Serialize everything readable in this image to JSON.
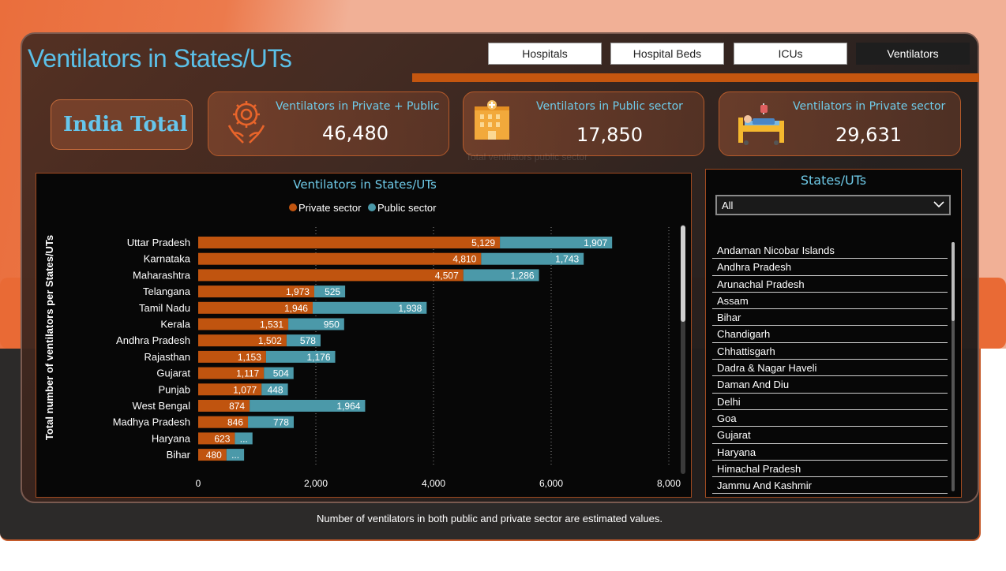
{
  "page": {
    "title": "Ventilators in States/UTs",
    "footer_note": "Number of ventilators in both public and private sector are estimated values."
  },
  "tabs": [
    {
      "label": "Hospitals",
      "active": false
    },
    {
      "label": "Hospital Beds",
      "active": false
    },
    {
      "label": "ICUs",
      "active": false
    },
    {
      "label": "Ventilators",
      "active": true
    }
  ],
  "india_total": {
    "label": "India Total"
  },
  "kpis": [
    {
      "label": "Ventilators in Private + Public",
      "value": "46,480",
      "icon": "hands-care-icon"
    },
    {
      "label": "Ventilators in Public sector",
      "value": "17,850",
      "icon": "hospital-building-icon"
    },
    {
      "label": "Ventilators in Private sector",
      "value": "29,631",
      "icon": "hospital-bed-icon"
    }
  ],
  "ghost_text": "Total ventilators public sector",
  "states_filter": {
    "title": "States/UTs",
    "selected": "All",
    "items": [
      "Andaman Nicobar Islands",
      "Andhra Pradesh",
      "Arunachal Pradesh",
      "Assam",
      "Bihar",
      "Chandigarh",
      "Chhattisgarh",
      "Dadra & Nagar Haveli",
      "Daman And Diu",
      "Delhi",
      "Goa",
      "Gujarat",
      "Haryana",
      "Himachal Pradesh",
      "Jammu And Kashmir"
    ]
  },
  "colors": {
    "private": "#c0540f",
    "public": "#4b99a9",
    "accent_blue": "#5bc0e8"
  },
  "chart_data": {
    "type": "bar",
    "orientation": "horizontal",
    "stacked": true,
    "title": "Ventilators in States/UTs",
    "ylabel": "Total number of ventilators per States/UTs",
    "xlabel": "",
    "xlim": [
      0,
      8000
    ],
    "x_ticks": [
      0,
      2000,
      4000,
      6000,
      8000
    ],
    "x_tick_labels": [
      "0",
      "2,000",
      "4,000",
      "6,000",
      "8,000"
    ],
    "grid": true,
    "legend_position": "top-center",
    "categories": [
      "Uttar Pradesh",
      "Karnataka",
      "Maharashtra",
      "Telangana",
      "Tamil Nadu",
      "Kerala",
      "Andhra Pradesh",
      "Rajasthan",
      "Gujarat",
      "Punjab",
      "West Bengal",
      "Madhya Pradesh",
      "Haryana",
      "Bihar"
    ],
    "series": [
      {
        "name": "Private sector",
        "values": [
          5129,
          4810,
          4507,
          1973,
          1946,
          1531,
          1502,
          1153,
          1117,
          1077,
          874,
          846,
          623,
          480
        ],
        "labels": [
          "5,129",
          "4,810",
          "4,507",
          "1,973",
          "1,946",
          "1,531",
          "1,502",
          "1,153",
          "1,117",
          "1,077",
          "874",
          "846",
          "623",
          "480"
        ]
      },
      {
        "name": "Public sector",
        "values": [
          1907,
          1743,
          1286,
          525,
          1938,
          950,
          578,
          1176,
          504,
          448,
          1964,
          778,
          300,
          300
        ],
        "labels": [
          "1,907",
          "1,743",
          "1,286",
          "525",
          "1,938",
          "950",
          "578",
          "1,176",
          "504",
          "448",
          "1,964",
          "778",
          "...",
          "..."
        ]
      }
    ]
  }
}
